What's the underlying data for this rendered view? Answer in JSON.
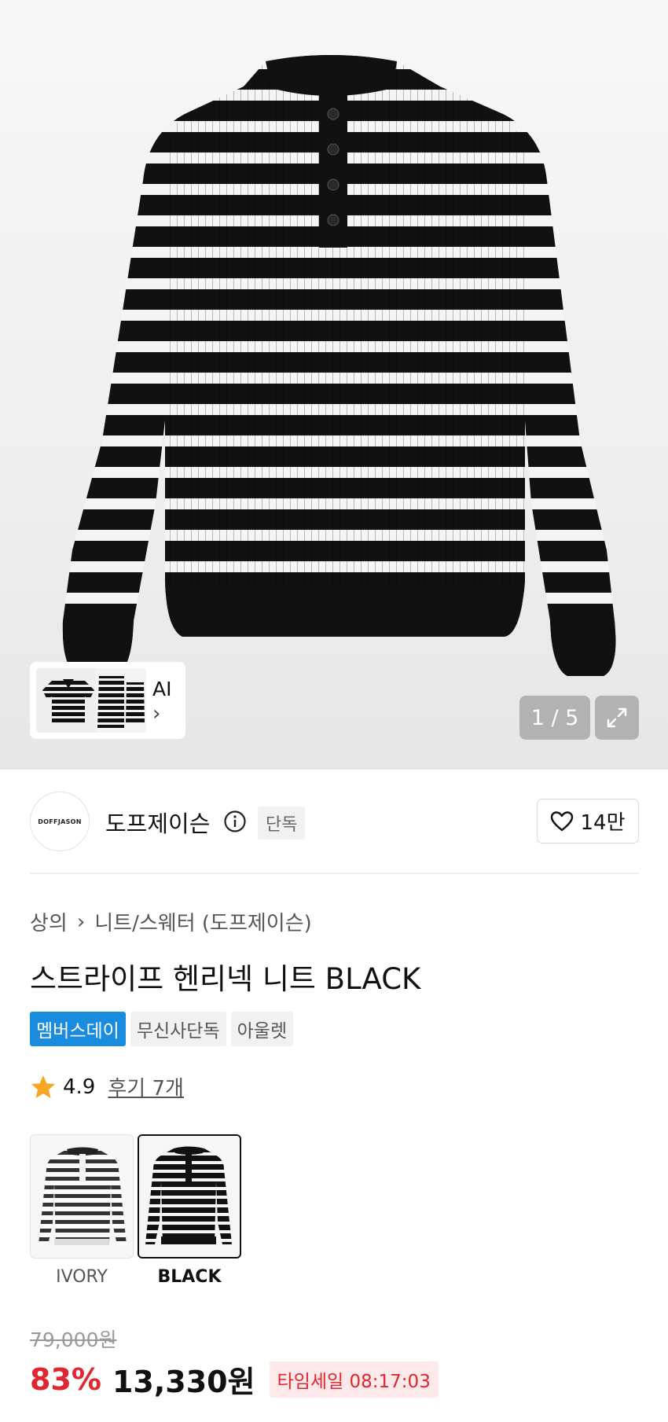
{
  "gallery": {
    "ai_label": "AI",
    "counter": "1 / 5"
  },
  "brand": {
    "logo_text": "DOFFJASON",
    "name": "도프제이슨",
    "badge": "단독",
    "likes": "14만"
  },
  "breadcrumb": [
    "상의",
    "니트/스웨터 (도프제이슨)"
  ],
  "product": {
    "title": "스트라이프 헨리넥 니트 BLACK",
    "tags": [
      "멤버스데이",
      "무신사단독",
      "아울렛"
    ],
    "rating": "4.9",
    "reviews": "후기 7개"
  },
  "options": [
    {
      "label": "IVORY",
      "selected": false
    },
    {
      "label": "BLACK",
      "selected": true
    }
  ],
  "price": {
    "original": "79,000원",
    "discount": "83%",
    "sale": "13,330원",
    "timesale": "타임세일 08:17:03"
  },
  "colors": {
    "accent_red": "#e0262f",
    "member_blue": "#1a8ce0",
    "star": "#f5a623"
  }
}
